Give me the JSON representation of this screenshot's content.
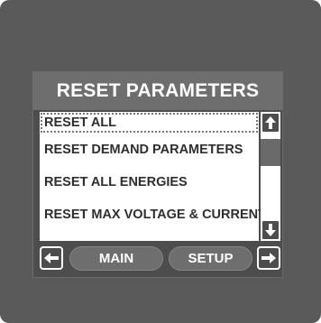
{
  "screen": {
    "title": "RESET PARAMETERS"
  },
  "menu": {
    "items": [
      {
        "label": "RESET ALL",
        "selected": true
      },
      {
        "label": "RESET DEMAND PARAMETERS",
        "selected": false
      },
      {
        "label": "RESET ALL ENERGIES",
        "selected": false
      },
      {
        "label": "RESET MAX VOLTAGE & CURRENT",
        "selected": false
      }
    ]
  },
  "scrollbar": {
    "up_icon": "arrow-up-icon",
    "down_icon": "arrow-down-icon"
  },
  "footer": {
    "left_icon": "arrow-left-icon",
    "right_icon": "arrow-right-icon",
    "main_label": "MAIN",
    "setup_label": "SETUP"
  },
  "colors": {
    "bezel": "#5a5a5a",
    "screen_bg": "#4d4d4d",
    "title_bg": "#6e6e6e",
    "text_light": "#ffffff",
    "text_dark": "#2e2e2e"
  }
}
